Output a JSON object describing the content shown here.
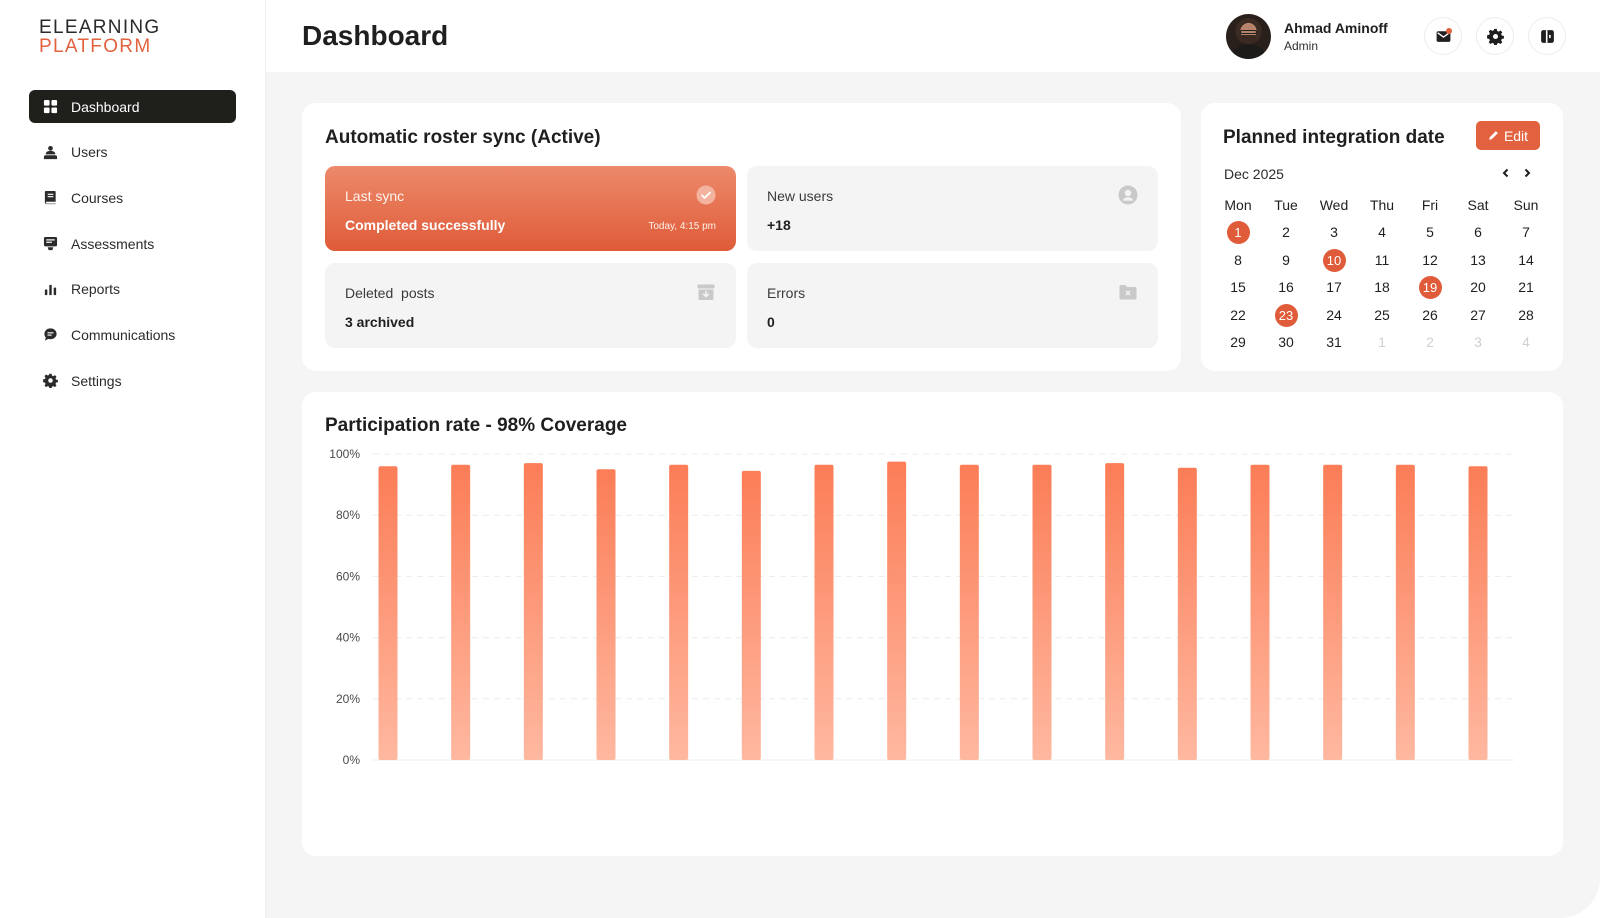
{
  "brand": {
    "line1": "ELEARNING",
    "line2": "PLATFORM"
  },
  "sidebar": {
    "items": [
      {
        "label": "Dashboard",
        "icon": "grid-icon",
        "active": true
      },
      {
        "label": "Users",
        "icon": "users-icon",
        "active": false
      },
      {
        "label": "Courses",
        "icon": "book-icon",
        "active": false
      },
      {
        "label": "Assessments",
        "icon": "assessment-icon",
        "active": false
      },
      {
        "label": "Reports",
        "icon": "bar-chart-icon",
        "active": false
      },
      {
        "label": "Communications",
        "icon": "chat-icon",
        "active": false
      },
      {
        "label": "Settings",
        "icon": "gear-icon",
        "active": false
      }
    ]
  },
  "header": {
    "title": "Dashboard",
    "user": {
      "name": "Ahmad Aminoff",
      "role": "Admin"
    },
    "buttons": [
      "mail-icon",
      "gear-icon",
      "logout-icon"
    ]
  },
  "sync": {
    "title": "Automatic roster sync (Active)",
    "tiles": [
      {
        "label": "Last sync",
        "value": "Completed successfully",
        "sub": "Today, 4:15 pm",
        "icon": "check-circle-icon"
      },
      {
        "label": "New users",
        "value": "+18",
        "icon": "user-circle-icon"
      },
      {
        "label": "Deleted  posts",
        "value": "3 archived",
        "icon": "archive-icon"
      },
      {
        "label": "Errors",
        "value": "0",
        "icon": "folder-x-icon"
      }
    ]
  },
  "calendar": {
    "title": "Planned integration date",
    "edit_label": "Edit",
    "month": "Dec 2025",
    "weekdays": [
      "Mon",
      "Tue",
      "Wed",
      "Thu",
      "Fri",
      "Sat",
      "Sun"
    ],
    "weeks": [
      [
        "1",
        "2",
        "3",
        "4",
        "5",
        "6",
        "7"
      ],
      [
        "8",
        "9",
        "10",
        "11",
        "12",
        "13",
        "14"
      ],
      [
        "15",
        "16",
        "17",
        "18",
        "19",
        "20",
        "21"
      ],
      [
        "22",
        "23",
        "24",
        "25",
        "26",
        "27",
        "28"
      ],
      [
        "29",
        "30",
        "31",
        "1",
        "2",
        "3",
        "4"
      ]
    ],
    "marked": [
      "1",
      "10",
      "19",
      "23"
    ],
    "trailing_muted_count": 4
  },
  "colors": {
    "accent": "#e2623f",
    "dark": "#1f1f1b",
    "bar_top": "#fb7d57",
    "bar_bottom": "#ffb8a0"
  },
  "chart_data": {
    "type": "bar",
    "title": "Participation rate - 98% Coverage",
    "ylim": [
      0,
      100
    ],
    "yticks": [
      "0%",
      "20%",
      "40%",
      "60%",
      "80%",
      "100%"
    ],
    "ytick_values": [
      0,
      20,
      40,
      60,
      80,
      100
    ],
    "grid": true,
    "values": [
      96,
      96.5,
      97,
      95,
      96.5,
      94.5,
      96.5,
      97.5,
      96.5,
      96.5,
      97,
      95.5,
      96.5,
      96.5,
      96.5,
      96
    ]
  }
}
